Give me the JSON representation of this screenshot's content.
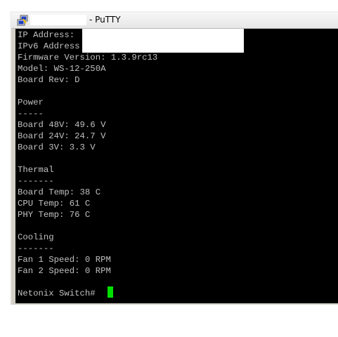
{
  "window": {
    "title": "- PuTTY"
  },
  "terminal": {
    "lines": [
      "IP Address:",
      "IPv6 Address",
      "Firmware Version: 1.3.9rc13",
      "Model: WS-12-250A",
      "Board Rev: D",
      "",
      "Power",
      "-----",
      "Board 48V: 49.6 V",
      "Board 24V: 24.7 V",
      "Board 3V: 3.3 V",
      "",
      "Thermal",
      "-------",
      "Board Temp: 38 C",
      "CPU Temp: 61 C",
      "PHY Temp: 76 C",
      "",
      "Cooling",
      "-------",
      "Fan 1 Speed: 0 RPM",
      "Fan 2 Speed: 0 RPM",
      "",
      "Netonix Switch#"
    ],
    "prompt": "Netonix Switch#",
    "text_color": "#c0c0c0",
    "background_color": "#000000",
    "cursor_color": "#00e000"
  },
  "icons": {
    "app_icon": "putty-icon"
  }
}
